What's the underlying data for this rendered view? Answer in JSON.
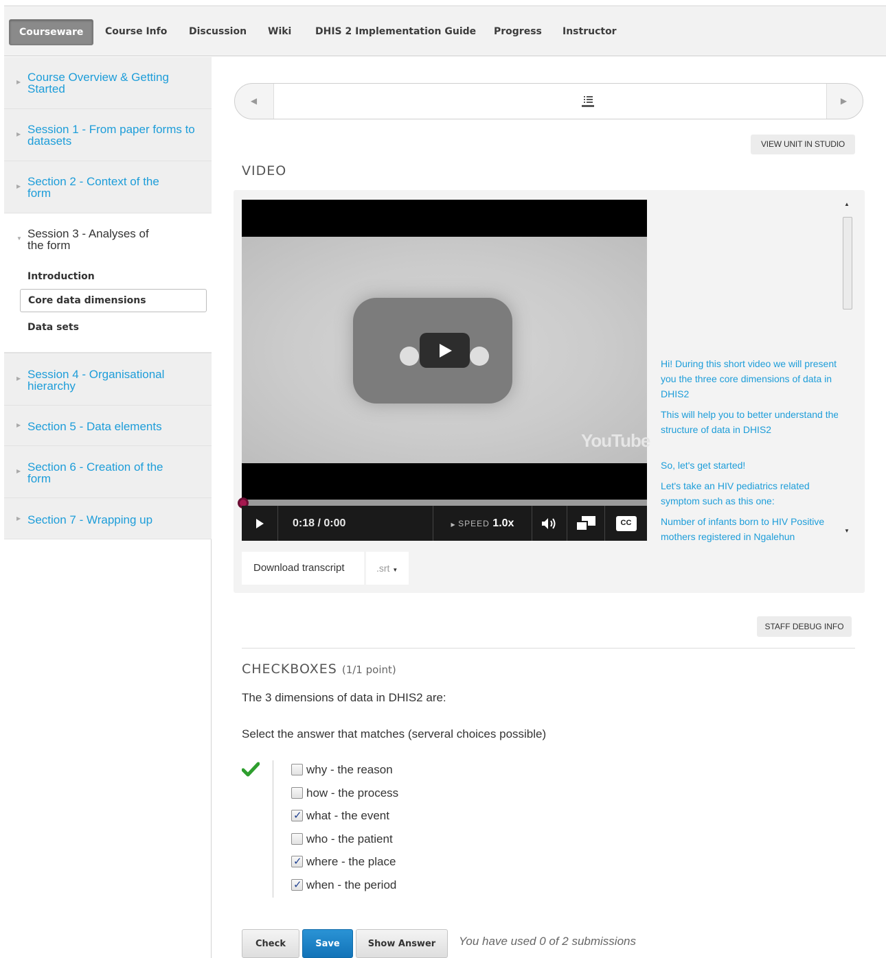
{
  "topnav": {
    "tabs": [
      "Courseware",
      "Course Info",
      "Discussion",
      "Wiki",
      "DHIS 2 Implementation Guide",
      "Progress",
      "Instructor"
    ],
    "active": "Courseware"
  },
  "sidebar": {
    "chapters": [
      {
        "label": "Course Overview & Getting Started"
      },
      {
        "label": "Session 1 - From paper forms to datasets"
      },
      {
        "label": "Section 2 - Context of the form"
      },
      {
        "label": "Session 3 - Analyses of the form"
      },
      {
        "label": "Session 4 - Organisational hierarchy"
      },
      {
        "label": "Section 5 - Data elements"
      },
      {
        "label": "Section 6 - Creation of the form"
      },
      {
        "label": "Section 7 - Wrapping up"
      }
    ],
    "subsections": [
      "Introduction",
      "Core data dimensions",
      "Data sets"
    ],
    "active_subsection": "Core data dimensions"
  },
  "sequence_nav": {
    "prev_icon": "triangle-left-icon",
    "next_icon": "triangle-right-icon",
    "unit_icon": "list-icon"
  },
  "studio_button": "VIEW UNIT IN STUDIO",
  "video": {
    "heading": "VIDEO",
    "time": "0:18 / 0:00",
    "speed_label": "SPEED",
    "speed_value": "1.0x",
    "cc_label": "CC",
    "yt_logo": "YouTube",
    "progress": 0.0,
    "transcript": [
      "Hi! During this short video we will present you the three core dimensions of data in DHIS2",
      "This will help you to better understand the structure of data in DHIS2",
      "So, let's get started!",
      "Let's take an HIV pediatrics related symptom such as this one:",
      "Number of infants born to HIV Positive mothers registered in Ngalehun community health center"
    ],
    "download_label": "Download transcript",
    "format_label": ".srt"
  },
  "debug_button": "STAFF DEBUG INFO",
  "problem": {
    "heading": "CHECKBOXES",
    "points": "(1/1 point)",
    "question": "The 3 dimensions of data in DHIS2 are:",
    "instruction": "Select the answer that matches (serveral choices possible)",
    "status_icon": "checkmark-icon",
    "status_color": "#2e9e2e",
    "choices": [
      {
        "label": "why - the reason",
        "checked": false
      },
      {
        "label": "how - the process",
        "checked": false
      },
      {
        "label": "what - the event",
        "checked": true
      },
      {
        "label": "who - the patient",
        "checked": false
      },
      {
        "label": "where - the place",
        "checked": true
      },
      {
        "label": "when - the period",
        "checked": true
      }
    ],
    "buttons": {
      "check": "Check",
      "save": "Save",
      "show_answer": "Show Answer"
    },
    "submissions_note": "You have used 0 of 2 submissions"
  },
  "colors": {
    "link": "#1d9dd9",
    "save_button": "#1a7fc6",
    "scrubber": "#a5184f"
  }
}
